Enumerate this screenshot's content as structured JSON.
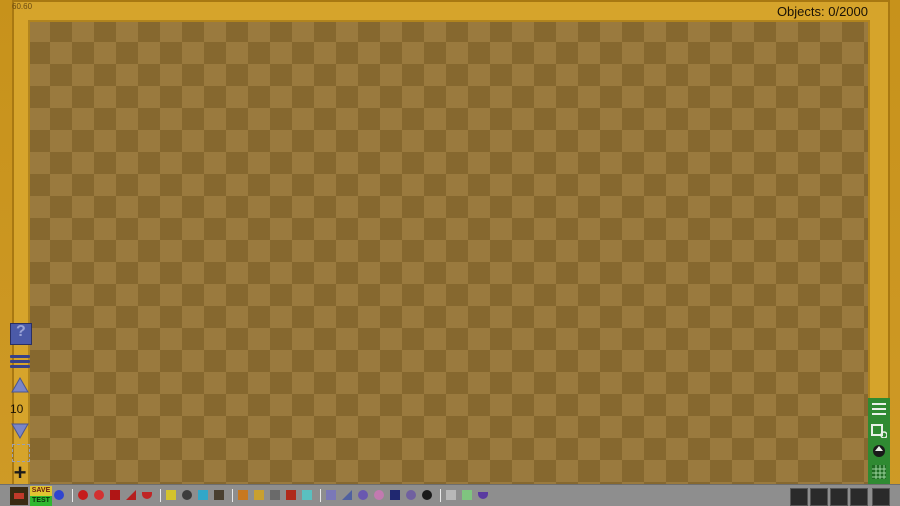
{
  "hud": {
    "fps": "60.60",
    "objects": "Objects: 0/2000"
  },
  "left_toolbar": {
    "help": "?",
    "layer_number": "10",
    "add": "+"
  },
  "bottom_bar": {
    "save": "SAVE",
    "test": "TEST"
  },
  "colors": {
    "frame": "#d6a42b",
    "canvas_light": "#9a7a3e",
    "canvas_dark": "#86682f",
    "right_bar": "#2f8a32",
    "bottom_bar": "#8e8e8e"
  },
  "palette": [
    {
      "icon": "blue-ball-icon",
      "color": "#2f45d0",
      "shape": "circle"
    },
    {
      "icon": "red-ball-icon",
      "color": "#c61d1d",
      "shape": "circle"
    },
    {
      "icon": "red-plus-ball-icon",
      "color": "#d23131",
      "shape": "circle"
    },
    {
      "icon": "red-block-icon",
      "color": "#b01515",
      "shape": "square"
    },
    {
      "icon": "red-ramp-icon",
      "color": "#b52020",
      "shape": "triangle"
    },
    {
      "icon": "red-half-icon",
      "color": "#c02525",
      "shape": "half"
    },
    {
      "icon": "yellow-block-icon",
      "color": "#d3c32c",
      "shape": "square"
    },
    {
      "icon": "gray-ball-icon",
      "color": "#3c3c3c",
      "shape": "circle"
    },
    {
      "icon": "cyan-c-icon",
      "color": "#32a7c9",
      "shape": "square"
    },
    {
      "icon": "dark-box-icon",
      "color": "#4a4030",
      "shape": "square"
    },
    {
      "icon": "orange-crate-icon",
      "color": "#c87820",
      "shape": "square"
    },
    {
      "icon": "striped-icon",
      "color": "#c8a030",
      "shape": "square"
    },
    {
      "icon": "ladder-icon",
      "color": "#6a6a6a",
      "shape": "square"
    },
    {
      "icon": "red-box-icon",
      "color": "#b02a1a",
      "shape": "square"
    },
    {
      "icon": "teal-tile-icon",
      "color": "#5ac0c0",
      "shape": "square"
    },
    {
      "icon": "purple-frame-icon",
      "color": "#7a78b8",
      "shape": "square"
    },
    {
      "icon": "slope-icon",
      "color": "#5060a0",
      "shape": "triangle"
    },
    {
      "icon": "purple-ring-icon",
      "color": "#6a58b0",
      "shape": "circle"
    },
    {
      "icon": "pink-ball-icon",
      "color": "#c27ab0",
      "shape": "circle"
    },
    {
      "icon": "navy-box-icon",
      "color": "#202870",
      "shape": "square"
    },
    {
      "icon": "purple-oval-icon",
      "color": "#7060a0",
      "shape": "circle"
    },
    {
      "icon": "pin-icon",
      "color": "#1a1a1a",
      "shape": "circle"
    },
    {
      "icon": "gear-box-icon",
      "color": "#b8b8b8",
      "shape": "square"
    },
    {
      "icon": "green-tile-icon",
      "color": "#7fc47f",
      "shape": "square"
    },
    {
      "icon": "purple-bowl-icon",
      "color": "#5a3aa0",
      "shape": "half"
    }
  ]
}
